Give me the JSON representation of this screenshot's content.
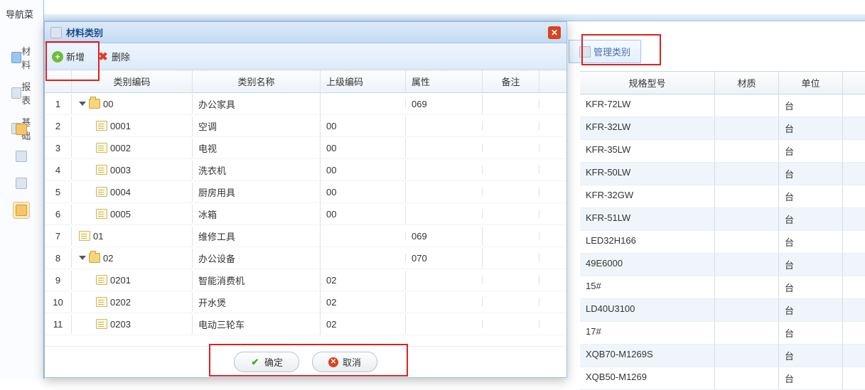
{
  "sidebar": {
    "title": "导航菜",
    "items": [
      "材料",
      "报表",
      "基础"
    ]
  },
  "background_tab": {
    "manage_label": "管理类别"
  },
  "background_table": {
    "headers": {
      "spec": "规格型号",
      "material": "材质",
      "unit": "单位"
    },
    "rows": [
      {
        "spec": "KFR-72LW",
        "material": "",
        "unit": "台"
      },
      {
        "spec": "KFR-32LW",
        "material": "",
        "unit": "台"
      },
      {
        "spec": "KFR-35LW",
        "material": "",
        "unit": "台"
      },
      {
        "spec": "KFR-50LW",
        "material": "",
        "unit": "台"
      },
      {
        "spec": "KFR-32GW",
        "material": "",
        "unit": "台"
      },
      {
        "spec": "KFR-51LW",
        "material": "",
        "unit": "台"
      },
      {
        "spec": "LED32H166",
        "material": "",
        "unit": "台"
      },
      {
        "spec": "49E6000",
        "material": "",
        "unit": "台"
      },
      {
        "spec": "15#",
        "material": "",
        "unit": "台"
      },
      {
        "spec": "LD40U3100",
        "material": "",
        "unit": "台"
      },
      {
        "spec": "17#",
        "material": "",
        "unit": "台"
      },
      {
        "spec": "XQB70-M1269S",
        "material": "",
        "unit": "台"
      },
      {
        "spec": "XQB50-M1269",
        "material": "",
        "unit": "台"
      }
    ]
  },
  "dialog": {
    "title": "材料类别",
    "toolbar": {
      "add_label": "新增",
      "delete_label": "删除"
    },
    "headers": {
      "code": "类别编码",
      "name": "类别名称",
      "parent": "上级编码",
      "attr": "属性",
      "note": "备注"
    },
    "rows": [
      {
        "n": "1",
        "icon": "folder",
        "expand": true,
        "indent": 1,
        "code": "00",
        "name": "办公家具",
        "parent": "",
        "attr": "069",
        "note": ""
      },
      {
        "n": "2",
        "icon": "file",
        "expand": false,
        "indent": 2,
        "code": "0001",
        "name": "空调",
        "parent": "00",
        "attr": "",
        "note": ""
      },
      {
        "n": "3",
        "icon": "file",
        "expand": false,
        "indent": 2,
        "code": "0002",
        "name": "电视",
        "parent": "00",
        "attr": "",
        "note": ""
      },
      {
        "n": "4",
        "icon": "file",
        "expand": false,
        "indent": 2,
        "code": "0003",
        "name": "洗衣机",
        "parent": "00",
        "attr": "",
        "note": ""
      },
      {
        "n": "5",
        "icon": "file",
        "expand": false,
        "indent": 2,
        "code": "0004",
        "name": "厨房用具",
        "parent": "00",
        "attr": "",
        "note": ""
      },
      {
        "n": "6",
        "icon": "file",
        "expand": false,
        "indent": 2,
        "code": "0005",
        "name": "冰箱",
        "parent": "00",
        "attr": "",
        "note": ""
      },
      {
        "n": "7",
        "icon": "file",
        "expand": false,
        "indent": 1,
        "code": "01",
        "name": "维修工具",
        "parent": "",
        "attr": "069",
        "note": ""
      },
      {
        "n": "8",
        "icon": "folder",
        "expand": true,
        "indent": 1,
        "code": "02",
        "name": "办公设备",
        "parent": "",
        "attr": "070",
        "note": ""
      },
      {
        "n": "9",
        "icon": "file",
        "expand": false,
        "indent": 2,
        "code": "0201",
        "name": "智能消费机",
        "parent": "02",
        "attr": "",
        "note": ""
      },
      {
        "n": "10",
        "icon": "file",
        "expand": false,
        "indent": 2,
        "code": "0202",
        "name": "开水煲",
        "parent": "02",
        "attr": "",
        "note": ""
      },
      {
        "n": "11",
        "icon": "file",
        "expand": false,
        "indent": 2,
        "code": "0203",
        "name": "电动三轮车",
        "parent": "02",
        "attr": "",
        "note": ""
      }
    ],
    "footer": {
      "ok_label": "确定",
      "cancel_label": "取消"
    }
  }
}
